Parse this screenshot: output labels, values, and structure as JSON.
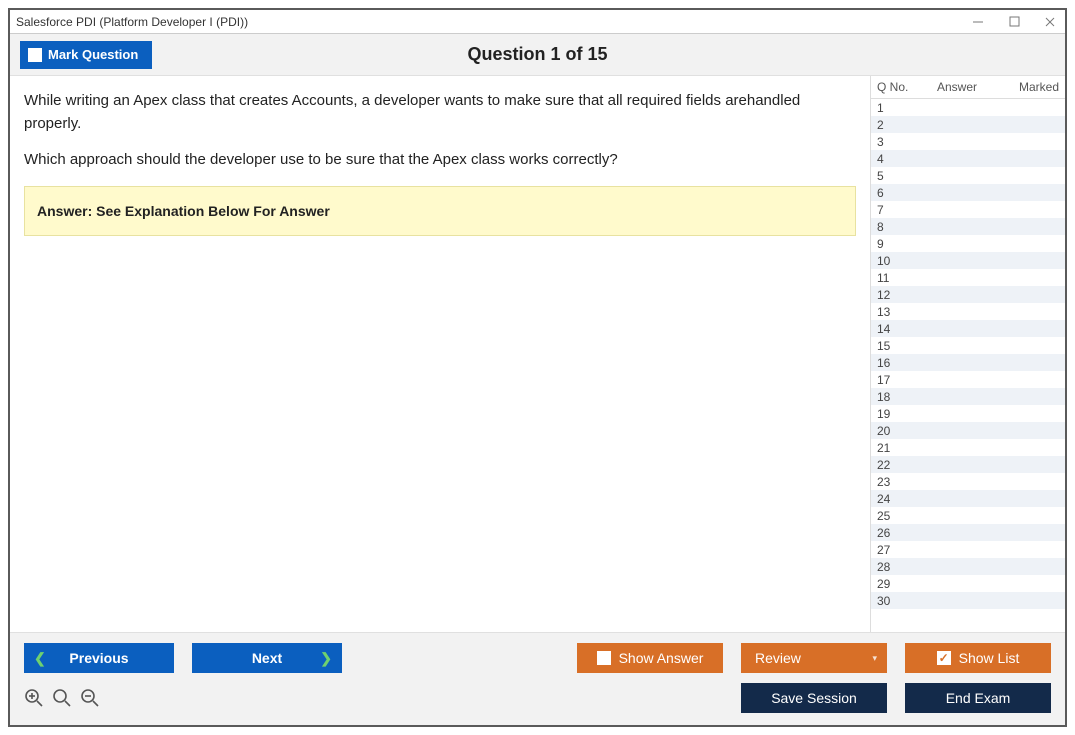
{
  "window_title": "Salesforce PDI (Platform Developer I (PDI))",
  "toolbar": {
    "mark_label": "Mark Question",
    "question_header": "Question 1 of 15"
  },
  "question": {
    "line1": "While writing an Apex class that creates Accounts, a developer wants to make sure that all required fields arehandled properly.",
    "line2": "Which approach should the developer use to be sure that the Apex class works correctly?",
    "answer_box": "Answer: See Explanation Below For Answer"
  },
  "sidebar": {
    "col_qno": "Q No.",
    "col_answer": "Answer",
    "col_marked": "Marked",
    "rows": [
      1,
      2,
      3,
      4,
      5,
      6,
      7,
      8,
      9,
      10,
      11,
      12,
      13,
      14,
      15,
      16,
      17,
      18,
      19,
      20,
      21,
      22,
      23,
      24,
      25,
      26,
      27,
      28,
      29,
      30
    ]
  },
  "buttons": {
    "previous": "Previous",
    "next": "Next",
    "show_answer": "Show Answer",
    "review": "Review",
    "show_list": "Show List",
    "save_session": "Save Session",
    "end_exam": "End Exam"
  }
}
